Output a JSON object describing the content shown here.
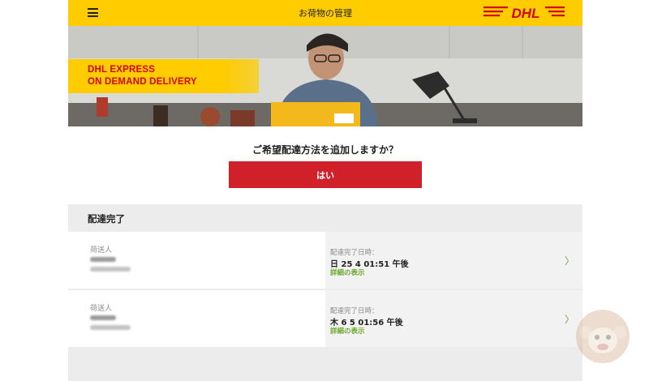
{
  "header": {
    "title": "お荷物の管理",
    "logo_text": "DHL"
  },
  "hero": {
    "badge_line1": "DHL EXPRESS",
    "badge_line2": "ON DEMAND DELIVERY"
  },
  "question": {
    "text": "ご希望配達方法を追加しますか？",
    "yes_label": "はい"
  },
  "section": {
    "title": "配達完了"
  },
  "shipments": [
    {
      "sender_label": "荷送人",
      "date_label": "配達完了日時：",
      "date_value": "日 25 4 01:51 午後",
      "detail_label": "詳細の表示",
      "chevron": "〉"
    },
    {
      "sender_label": "荷送人",
      "date_label": "配達完了日時：",
      "date_value": "木 6 5 01:56 午後",
      "detail_label": "詳細の表示",
      "chevron": "〉"
    }
  ],
  "colors": {
    "brand_yellow": "#ffcc00",
    "brand_red": "#d40511",
    "button_red": "#d0202a",
    "link_green": "#6aa82b"
  }
}
